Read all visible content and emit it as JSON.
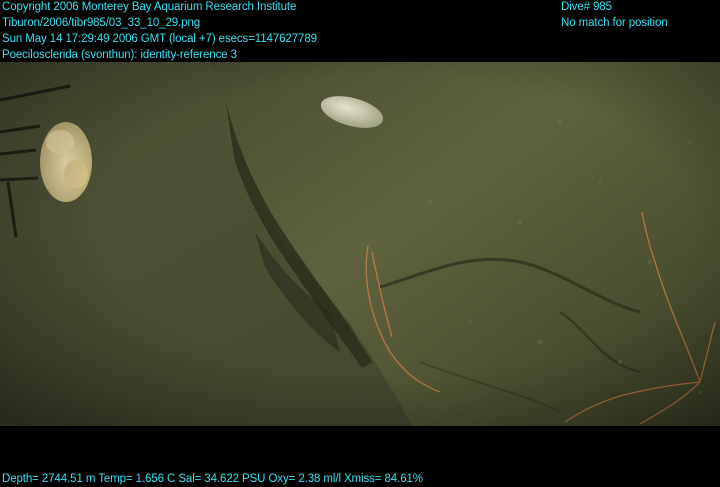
{
  "header_left": {
    "copyright": "Copyright 2006 Monterey Bay Aquarium Research Institute",
    "filename": "Tiburon/2006/tibr985/03_33_10_29.png",
    "timestamp": "Sun May 14 17:29:49 2006 GMT (local +7)  esecs=1147627789",
    "annotation": "Poecilosclerida (svonthun): identity-reference 3"
  },
  "header_right": {
    "dive": "Dive# 985",
    "position": "No match for position"
  },
  "footer": {
    "telemetry": "Depth= 2744.51 m  Temp= 1.656 C  Sal= 34.622 PSU  Oxy= 2.38 ml/l  Xmiss= 84.61%"
  },
  "colors": {
    "overlay_text": "#35e0f0",
    "background": "#000000",
    "sediment": "#55583a",
    "rock": "#5c5f3c"
  }
}
